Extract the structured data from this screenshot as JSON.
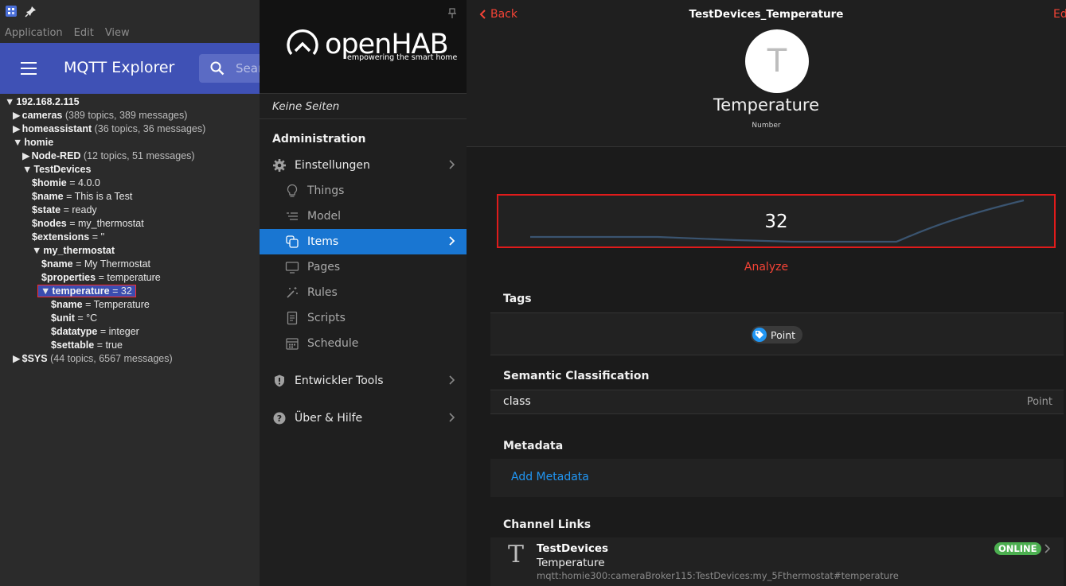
{
  "mqtt_explorer": {
    "menu": [
      "Application",
      "Edit",
      "View"
    ],
    "title": "MQTT Explorer",
    "search_placeholder": "Search",
    "tree": [
      {
        "indent": 0,
        "arrow": "▼",
        "name": "192.168.2.115",
        "value": "",
        "meta": ""
      },
      {
        "indent": 1,
        "arrow": "▶",
        "name": "cameras",
        "value": "",
        "meta": "(389 topics, 389 messages)"
      },
      {
        "indent": 1,
        "arrow": "▶",
        "name": "homeassistant",
        "value": "",
        "meta": "(36 topics, 36 messages)"
      },
      {
        "indent": 1,
        "arrow": "▼",
        "name": "homie",
        "value": "",
        "meta": ""
      },
      {
        "indent": 2,
        "arrow": "▶",
        "name": "Node-RED",
        "value": "",
        "meta": "(12 topics, 51 messages)"
      },
      {
        "indent": 2,
        "arrow": "▼",
        "name": "TestDevices",
        "value": "",
        "meta": ""
      },
      {
        "indent": 3,
        "arrow": "",
        "name": "$homie",
        "value": "= 4.0.0",
        "meta": ""
      },
      {
        "indent": 3,
        "arrow": "",
        "name": "$name",
        "value": "= This is a Test",
        "meta": ""
      },
      {
        "indent": 3,
        "arrow": "",
        "name": "$state",
        "value": "= ready",
        "meta": ""
      },
      {
        "indent": 3,
        "arrow": "",
        "name": "$nodes",
        "value": "= my_thermostat",
        "meta": ""
      },
      {
        "indent": 3,
        "arrow": "",
        "name": "$extensions",
        "value": "= ''",
        "meta": ""
      },
      {
        "indent": 3,
        "arrow": "▼",
        "name": "my_thermostat",
        "value": "",
        "meta": ""
      },
      {
        "indent": 4,
        "arrow": "",
        "name": "$name",
        "value": "= My Thermostat",
        "meta": ""
      },
      {
        "indent": 4,
        "arrow": "",
        "name": "$properties",
        "value": "= temperature",
        "meta": ""
      },
      {
        "indent": 4,
        "arrow": "▼",
        "name": "temperature",
        "value": "= 32",
        "meta": "",
        "selected": true
      },
      {
        "indent": 5,
        "arrow": "",
        "name": "$name",
        "value": "= Temperature",
        "meta": ""
      },
      {
        "indent": 5,
        "arrow": "",
        "name": "$unit",
        "value": "= °C",
        "meta": ""
      },
      {
        "indent": 5,
        "arrow": "",
        "name": "$datatype",
        "value": "= integer",
        "meta": ""
      },
      {
        "indent": 5,
        "arrow": "",
        "name": "$settable",
        "value": "= true",
        "meta": ""
      },
      {
        "indent": 1,
        "arrow": "▶",
        "name": "$SYS",
        "value": "",
        "meta": "(44 topics, 6567 messages)"
      }
    ]
  },
  "sidebar": {
    "logo_text": "openHAB",
    "logo_subtitle": "empowering the smart home",
    "no_pages": "Keine Seiten",
    "admin_title": "Administration",
    "items": [
      {
        "label": "Einstellungen",
        "icon": "gear-icon",
        "sub": false,
        "chevron": true
      },
      {
        "label": "Things",
        "icon": "lightbulb-icon",
        "sub": true
      },
      {
        "label": "Model",
        "icon": "list-icon",
        "sub": true
      },
      {
        "label": "Items",
        "icon": "items-icon",
        "sub": true,
        "active": true,
        "chevron": true
      },
      {
        "label": "Pages",
        "icon": "monitor-icon",
        "sub": true
      },
      {
        "label": "Rules",
        "icon": "wand-icon",
        "sub": true
      },
      {
        "label": "Scripts",
        "icon": "document-icon",
        "sub": true
      },
      {
        "label": "Schedule",
        "icon": "calendar-icon",
        "sub": true
      }
    ],
    "dev_tools": "Entwickler Tools",
    "help": "Über & Hilfe"
  },
  "main": {
    "back_label": "Back",
    "page_title": "TestDevices_Temperature",
    "edit_label": "Ed",
    "avatar_letter": "T",
    "item_label": "Temperature",
    "item_type": "Number",
    "state": "32",
    "analyze_label": "Analyze",
    "tags_title": "Tags",
    "tag": "Point",
    "semantic_title": "Semantic Classification",
    "semantic_key": "class",
    "semantic_value": "Point",
    "metadata_title": "Metadata",
    "add_metadata": "Add Metadata",
    "channel_links_title": "Channel Links",
    "link": {
      "letter": "T",
      "thing": "TestDevices",
      "channel": "Temperature",
      "uid": "mqtt:homie300:cameraBroker115:TestDevices:my_5Fthermostat#temperature",
      "status": "ONLINE"
    }
  },
  "colors": {
    "mqtt_appbar": "#3f51b5",
    "oh_accent": "#f44336",
    "active_blue": "#1976d2",
    "link_blue": "#2196f3",
    "online_green": "#4caf50"
  }
}
